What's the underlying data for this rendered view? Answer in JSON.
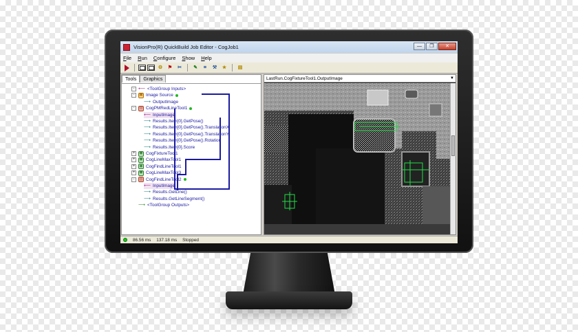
{
  "window": {
    "title": "VisionPro(R) QuickBuild Job Editor - CogJob1",
    "minimize_glyph": "—",
    "restore_glyph": "❐",
    "close_glyph": "✕"
  },
  "menu": [
    "File",
    "Run",
    "Configure",
    "Show",
    "Help"
  ],
  "toolbar": {
    "buttons": [
      {
        "name": "run-button",
        "icon": "play-icon"
      },
      {
        "name": "image-view-button",
        "icon": "image-icon"
      },
      {
        "name": "image-view2-button",
        "icon": "image-icon"
      },
      {
        "name": "tool-a-button",
        "glyph": "⚙"
      },
      {
        "name": "tool-b-button",
        "glyph": "⚑"
      },
      {
        "name": "tool-c-button",
        "glyph": "✂"
      },
      {
        "name": "tool-d-button",
        "glyph": "✎"
      },
      {
        "name": "tool-e-button",
        "glyph": "⌗"
      },
      {
        "name": "tool-f-button",
        "glyph": "⚒"
      },
      {
        "name": "tool-g-button",
        "glyph": "★"
      },
      {
        "name": "tool-h-button",
        "glyph": "▤"
      }
    ]
  },
  "tabs": [
    "Tools",
    "Graphics"
  ],
  "tree": [
    {
      "label": "<ToolGroup Inputs>",
      "type": "pink-arrow",
      "indent": 2,
      "pm": "-"
    },
    {
      "label": "Image Source",
      "type": "icon-orange",
      "indent": 2,
      "pm": "-",
      "ok": true
    },
    {
      "label": "OutputImage",
      "type": "teal-arrow",
      "indent": 3
    },
    {
      "label": "CogPMRedLineTool1",
      "type": "icon-red",
      "indent": 2,
      "pm": "-",
      "ok": true
    },
    {
      "label": "InputImage",
      "type": "pink-arrow",
      "indent": 3
    },
    {
      "label": "Results.Item[0].GetPose()",
      "type": "teal-arrow",
      "indent": 3
    },
    {
      "label": "Results.Item[0].GetPose().TranslationX",
      "type": "teal-arrow",
      "indent": 3
    },
    {
      "label": "Results.Item[0].GetPose().TranslationY",
      "type": "teal-arrow",
      "indent": 3
    },
    {
      "label": "Results.Item[0].GetPose().Rotation",
      "type": "teal-arrow",
      "indent": 3
    },
    {
      "label": "Results.Item[0].Score",
      "type": "teal-arrow",
      "indent": 3
    },
    {
      "label": "CogFixtureTool1",
      "type": "icon-green",
      "indent": 2,
      "pm": "+"
    },
    {
      "label": "CogLineMaxTool1",
      "type": "icon-green",
      "indent": 2,
      "pm": "+"
    },
    {
      "label": "CogFindLineTool1",
      "type": "icon-green",
      "indent": 2,
      "pm": "+"
    },
    {
      "label": "CogLineMaxTool3",
      "type": "icon-green",
      "indent": 2,
      "pm": "+"
    },
    {
      "label": "CogFindLineTool2",
      "type": "icon-red",
      "indent": 2,
      "pm": "-",
      "ok": true
    },
    {
      "label": "InputImage",
      "type": "pink-arrow",
      "indent": 3
    },
    {
      "label": "Results.GetLine()",
      "type": "teal-arrow",
      "indent": 3
    },
    {
      "label": "Results.GetLineSegment()",
      "type": "teal-arrow",
      "indent": 3
    },
    {
      "label": "<ToolGroup Outputs>",
      "type": "green-arrow",
      "indent": 2
    }
  ],
  "image_panel": {
    "header": "LastRun.CogFixtureTool1.OutputImage",
    "dropdown_glyph": "▼"
  },
  "status": {
    "time1": "86.56 ms",
    "time2": "137.18 ms",
    "state": "Stopped"
  },
  "colors": {
    "link_blue": "#1a1aa0",
    "ok_green": "#21b821",
    "overlay_green": "#22dd44"
  }
}
